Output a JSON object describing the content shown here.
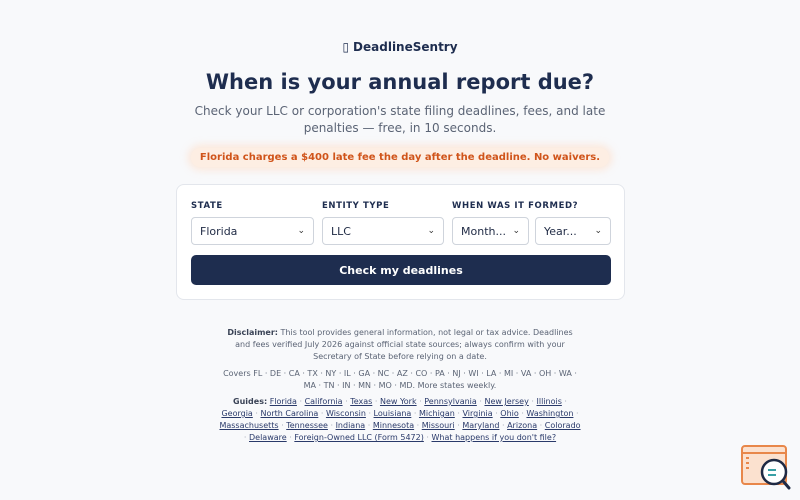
{
  "brand": {
    "logo_glyph": "▯",
    "name": "DeadlineSentry"
  },
  "hero": {
    "title": "When is your annual report due?",
    "subtitle": "Check your LLC or corporation's state filing deadlines, fees, and late penalties — free, in 10 seconds."
  },
  "alert": {
    "text": "Florida charges a $400 late fee the day after the deadline. No waivers.",
    "color": "#d0541a"
  },
  "form": {
    "state": {
      "label": "STATE",
      "value": "Florida"
    },
    "entity": {
      "label": "ENTITY TYPE",
      "value": "LLC"
    },
    "formed": {
      "label": "WHEN WAS IT FORMED?",
      "month": "Month...",
      "year": "Year..."
    },
    "submit_label": "Check my deadlines",
    "accent": "#1e2d4f"
  },
  "disclaimer": {
    "label": "Disclaimer:",
    "text": "This tool provides general information, not legal or tax advice. Deadlines and fees verified July 2026 against official state sources; always confirm with your Secretary of State before relying on a date."
  },
  "covers": "Covers FL · DE · CA · TX · NY · IL · GA · NC · AZ · CO · PA · NJ · WI · LA · MI · VA · OH · WA · MA · TN · IN · MN · MO · MD. More states weekly.",
  "guides": {
    "label": "Guides:",
    "links": [
      "Florida",
      "California",
      "Texas",
      "New York",
      "Pennsylvania",
      "New Jersey",
      "Illinois",
      "Georgia",
      "North Carolina",
      "Wisconsin",
      "Louisiana",
      "Michigan",
      "Virginia",
      "Ohio",
      "Washington",
      "Massachusetts",
      "Tennessee",
      "Indiana",
      "Minnesota",
      "Missouri",
      "Maryland",
      "Arizona",
      "Colorado",
      "Delaware",
      "Foreign-Owned LLC (Form 5472)",
      "What happens if you don't file?"
    ]
  },
  "widget": {
    "icon": "search-document-icon",
    "color": "#e8874a"
  }
}
